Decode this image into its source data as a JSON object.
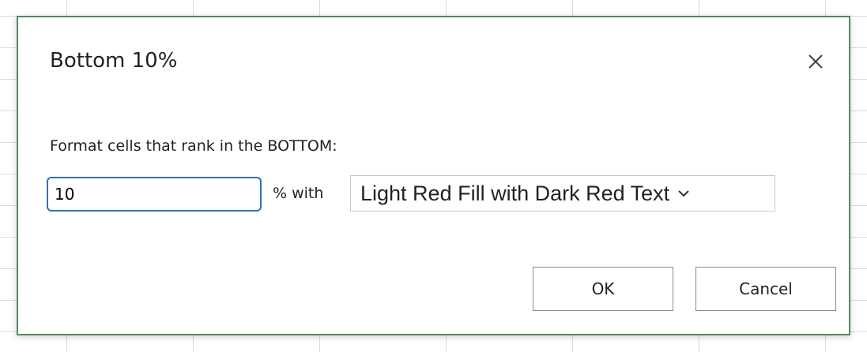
{
  "dialog": {
    "title": "Bottom 10%",
    "prompt": "Format cells that rank in the BOTTOM:",
    "rank_value": "10",
    "with_label": "% with",
    "format_selected": "Light Red Fill with Dark Red Text",
    "ok_label": "OK",
    "cancel_label": "Cancel"
  },
  "icons": {
    "close": "close-icon",
    "dropdown": "chevron-down-icon"
  },
  "colors": {
    "dialog_border": "#4b8f5f",
    "input_focus": "#2f6fd0"
  }
}
